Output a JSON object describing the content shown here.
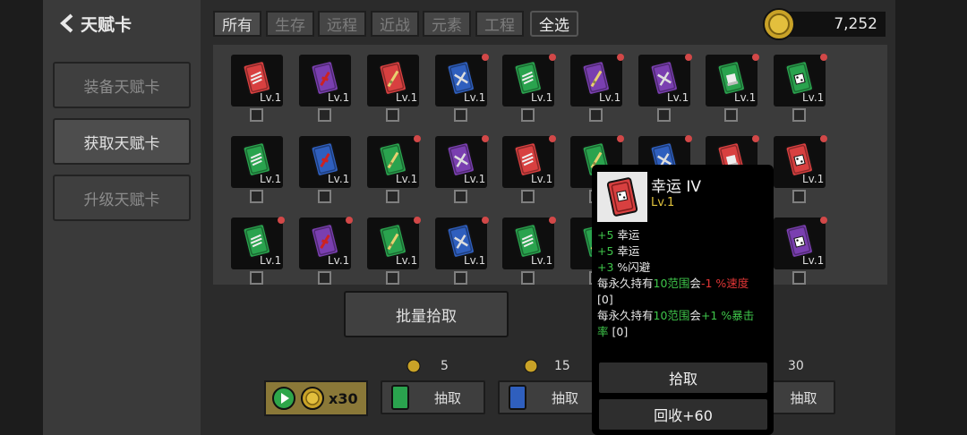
{
  "header": {
    "back_label": "天赋卡"
  },
  "sidebar": {
    "equip": "装备天赋卡",
    "obtain": "获取天赋卡",
    "upgrade": "升级天赋卡"
  },
  "filters": {
    "all_cat": "所有",
    "survival": "生存",
    "ranged": "远程",
    "melee": "近战",
    "element": "元素",
    "engineering": "工程",
    "select_all": "全选"
  },
  "coins": "7,252",
  "card_level": "Lv.1",
  "cards": [
    {
      "color": "#d84040",
      "icon": "boots",
      "dot": false
    },
    {
      "color": "#7a3fb0",
      "icon": "dash",
      "dot": false
    },
    {
      "color": "#d84040",
      "icon": "sword",
      "dot": false
    },
    {
      "color": "#2f5fbe",
      "icon": "cross",
      "dot": true
    },
    {
      "color": "#2aa34e",
      "icon": "boots",
      "dot": true
    },
    {
      "color": "#7a3fb0",
      "icon": "sword",
      "dot": true
    },
    {
      "color": "#7a3fb0",
      "icon": "cross",
      "dot": true
    },
    {
      "color": "#2aa34e",
      "icon": "glove",
      "dot": true
    },
    {
      "color": "#2aa34e",
      "icon": "dice",
      "dot": true
    },
    {
      "color": "#2aa34e",
      "icon": "boots",
      "dot": false
    },
    {
      "color": "#2f5fbe",
      "icon": "dash",
      "dot": false
    },
    {
      "color": "#2aa34e",
      "icon": "sword",
      "dot": true
    },
    {
      "color": "#7a3fb0",
      "icon": "cross",
      "dot": true
    },
    {
      "color": "#d84040",
      "icon": "boots",
      "dot": true
    },
    {
      "color": "#2aa34e",
      "icon": "sword",
      "dot": true
    },
    {
      "color": "#2f5fbe",
      "icon": "cross",
      "dot": true
    },
    {
      "color": "#d84040",
      "icon": "glove",
      "dot": true
    },
    {
      "color": "#d84040",
      "icon": "dice",
      "dot": true
    },
    {
      "color": "#2aa34e",
      "icon": "boots",
      "dot": true
    },
    {
      "color": "#7a3fb0",
      "icon": "dash",
      "dot": true
    },
    {
      "color": "#2aa34e",
      "icon": "sword",
      "dot": true
    },
    {
      "color": "#2f5fbe",
      "icon": "cross",
      "dot": true
    },
    {
      "color": "#2aa34e",
      "icon": "boots",
      "dot": true
    },
    {
      "color": "#2aa34e",
      "icon": "sword",
      "dot": true
    },
    {
      "color": "#2f5fbe",
      "icon": "cross",
      "dot": true
    },
    {
      "color": "#d84040",
      "icon": "glove",
      "dot": true
    },
    {
      "color": "#7a3fb0",
      "icon": "dice",
      "dot": true
    }
  ],
  "batch_label": "批量拾取",
  "draw": {
    "ad_count": "x30",
    "draw_label": "抽取",
    "costs": [
      "5",
      "15",
      "30"
    ]
  },
  "popup": {
    "title": "幸运 IV",
    "level": "Lv.1",
    "line1_val": "+5",
    "line1_txt": " 幸运",
    "line2_val": "+5",
    "line2_txt": " 幸运",
    "line3_val": "+3",
    "line3_txt": " %闪避",
    "line4_a": "每永久持有",
    "line4_b": "10范围",
    "line4_c": "会",
    "line4_d": "-1 %速度",
    "line5": "[0]",
    "line6_a": "每永久持有",
    "line6_b": "10范围",
    "line6_c": "会",
    "line6_d": "+1 %暴击",
    "line7_a": "率",
    "line7_b": " [0]",
    "pickup": "拾取",
    "recycle": "回收+60"
  },
  "colors": {
    "red_card": "#d84040",
    "green_card": "#2aa34e",
    "blue_card": "#2f5fbe",
    "purple_card": "#7a3fb0",
    "gold": "#c9a227"
  }
}
